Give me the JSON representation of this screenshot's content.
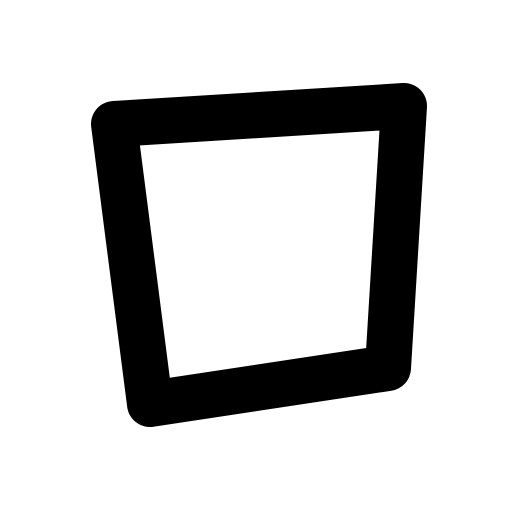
{
  "image": {
    "icon": "quadrilateral-outline-icon",
    "colors": {
      "background": "#ffffff",
      "stroke": "#000000"
    }
  }
}
